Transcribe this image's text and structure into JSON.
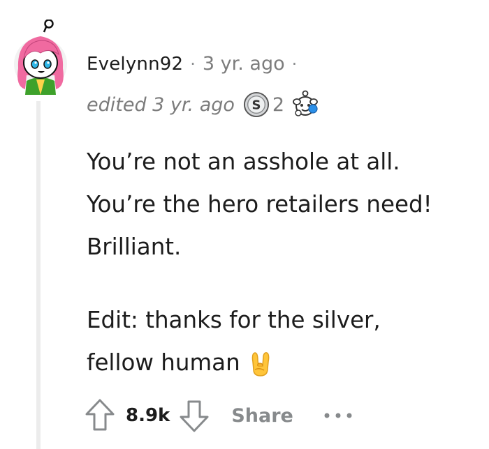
{
  "comment": {
    "username": "Evelynn92",
    "separator": "·",
    "time": "3 yr. ago",
    "time_separator": "·",
    "edited": "edited 3 yr. ago",
    "awards": [
      {
        "icon": "silver-award-icon",
        "count": "2"
      },
      {
        "icon": "wholesome-award-icon"
      }
    ],
    "body": [
      "You’re not an asshole at all.",
      "You’re the hero retailers need!",
      "Brilliant."
    ],
    "edit_line_1": "Edit: thanks for the silver,",
    "edit_line_2": "fellow human",
    "emoji": "sign-of-the-horns-emoji",
    "score": "8.9k",
    "share_label": "Share",
    "more_label": "more-options-icon"
  },
  "colors": {
    "text": "#1c1c1c",
    "muted": "#7c7c7c",
    "thread_line": "#ececec",
    "avatar_hair": "#f06aa0",
    "avatar_shirt": "#3ea12b"
  }
}
